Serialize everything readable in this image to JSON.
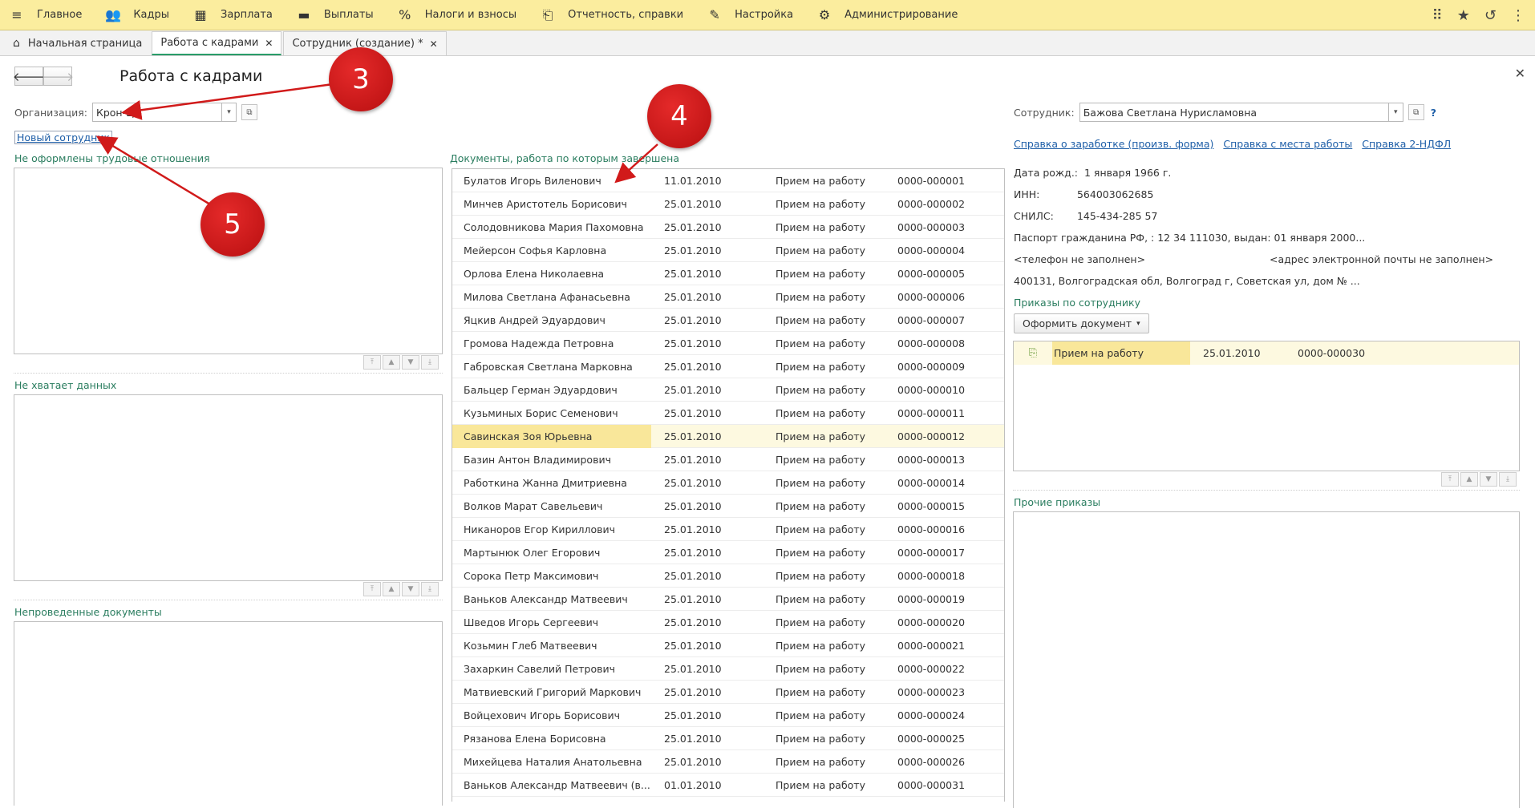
{
  "menu": {
    "items": [
      {
        "label": "Главное",
        "icon": "≡"
      },
      {
        "label": "Кадры",
        "icon": "👥"
      },
      {
        "label": "Зарплата",
        "icon": "▦"
      },
      {
        "label": "Выплаты",
        "icon": "▬"
      },
      {
        "label": "Налоги и взносы",
        "icon": "%"
      },
      {
        "label": "Отчетность, справки",
        "icon": "⎗"
      },
      {
        "label": "Настройка",
        "icon": "✎"
      },
      {
        "label": "Администрирование",
        "icon": "⚙"
      }
    ]
  },
  "tabs": [
    {
      "label": "Начальная страница"
    },
    {
      "label": "Работа с кадрами"
    },
    {
      "label": "Сотрудник (создание) *"
    }
  ],
  "form": {
    "title": "Работа с кадрами",
    "org_label": "Организация:",
    "org_value": "Крон-Ц",
    "new_employee_link": "Новый сотрудник"
  },
  "sections": {
    "not_formalized": "Не оформлены трудовые отношения",
    "missing_data": "Не хватает данных",
    "unposted_docs": "Непроведенные документы",
    "completed_docs": "Документы, работа по которым завершена",
    "employee_orders": "Приказы по сотруднику",
    "other_orders": "Прочие приказы"
  },
  "documents": [
    {
      "name": "Булатов Игорь Виленович",
      "date": "11.01.2010",
      "type": "Прием на работу",
      "num": "0000-000001"
    },
    {
      "name": "Минчев Аристотель Борисович",
      "date": "25.01.2010",
      "type": "Прием на работу",
      "num": "0000-000002"
    },
    {
      "name": "Солодовникова Мария Пахомовна",
      "date": "25.01.2010",
      "type": "Прием на работу",
      "num": "0000-000003"
    },
    {
      "name": "Мейерсон Софья Карловна",
      "date": "25.01.2010",
      "type": "Прием на работу",
      "num": "0000-000004"
    },
    {
      "name": "Орлова Елена Николаевна",
      "date": "25.01.2010",
      "type": "Прием на работу",
      "num": "0000-000005"
    },
    {
      "name": "Милова Светлана Афанасьевна",
      "date": "25.01.2010",
      "type": "Прием на работу",
      "num": "0000-000006"
    },
    {
      "name": "Яцкив Андрей Эдуардович",
      "date": "25.01.2010",
      "type": "Прием на работу",
      "num": "0000-000007"
    },
    {
      "name": "Громова Надежда Петровна",
      "date": "25.01.2010",
      "type": "Прием на работу",
      "num": "0000-000008"
    },
    {
      "name": "Габровская Светлана Марковна",
      "date": "25.01.2010",
      "type": "Прием на работу",
      "num": "0000-000009"
    },
    {
      "name": "Бальцер Герман Эдуардович",
      "date": "25.01.2010",
      "type": "Прием на работу",
      "num": "0000-000010"
    },
    {
      "name": "Кузьминых Борис Семенович",
      "date": "25.01.2010",
      "type": "Прием на работу",
      "num": "0000-000011"
    },
    {
      "name": "Савинская Зоя Юрьевна",
      "date": "25.01.2010",
      "type": "Прием на работу",
      "num": "0000-000012",
      "selected": true
    },
    {
      "name": "Базин Антон Владимирович",
      "date": "25.01.2010",
      "type": "Прием на работу",
      "num": "0000-000013"
    },
    {
      "name": "Работкина Жанна Дмитриевна",
      "date": "25.01.2010",
      "type": "Прием на работу",
      "num": "0000-000014"
    },
    {
      "name": "Волков Марат Савельевич",
      "date": "25.01.2010",
      "type": "Прием на работу",
      "num": "0000-000015"
    },
    {
      "name": "Никаноров Егор Кириллович",
      "date": "25.01.2010",
      "type": "Прием на работу",
      "num": "0000-000016"
    },
    {
      "name": "Мартынюк Олег Егорович",
      "date": "25.01.2010",
      "type": "Прием на работу",
      "num": "0000-000017"
    },
    {
      "name": "Сорока Петр Максимович",
      "date": "25.01.2010",
      "type": "Прием на работу",
      "num": "0000-000018"
    },
    {
      "name": "Ваньков Александр Матвеевич",
      "date": "25.01.2010",
      "type": "Прием на работу",
      "num": "0000-000019"
    },
    {
      "name": "Шведов Игорь Сергеевич",
      "date": "25.01.2010",
      "type": "Прием на работу",
      "num": "0000-000020"
    },
    {
      "name": "Козьмин Глеб Матвеевич",
      "date": "25.01.2010",
      "type": "Прием на работу",
      "num": "0000-000021"
    },
    {
      "name": "Захаркин Савелий Петрович",
      "date": "25.01.2010",
      "type": "Прием на работу",
      "num": "0000-000022"
    },
    {
      "name": "Матвиевский Григорий Маркович",
      "date": "25.01.2010",
      "type": "Прием на работу",
      "num": "0000-000023"
    },
    {
      "name": "Войцехович Игорь Борисович",
      "date": "25.01.2010",
      "type": "Прием на работу",
      "num": "0000-000024"
    },
    {
      "name": "Рязанова Елена Борисовна",
      "date": "25.01.2010",
      "type": "Прием на работу",
      "num": "0000-000025"
    },
    {
      "name": "Михейцева Наталия Анатольевна",
      "date": "25.01.2010",
      "type": "Прием на работу",
      "num": "0000-000026"
    },
    {
      "name": "Ваньков Александр Матвеевич (в...",
      "date": "01.01.2010",
      "type": "Прием на работу",
      "num": "0000-000031"
    }
  ],
  "employee": {
    "label": "Сотрудник:",
    "value": "Бажова Светлана Нурисламовна",
    "help": "?",
    "links": [
      "Справка о заработке (произв. форма)",
      "Справка с места работы",
      "Справка 2-НДФЛ"
    ],
    "birth_label": "Дата рожд.:",
    "birth": "1 января 1966 г.",
    "inn_label": "ИНН:",
    "inn": "564003062685",
    "snils_label": "СНИЛС:",
    "snils": "145-434-285 57",
    "passport": "Паспорт гражданина РФ, : 12 34 111030, выдан: 01 января 2000...",
    "phone": "<телефон не заполнен>",
    "email": "<адрес электронной почты не заполнен>",
    "address": "400131, Волгоградская обл, Волгоград г, Советская ул, дом № ...",
    "oformit_btn": "Оформить документ",
    "orders": [
      {
        "type": "Прием на работу",
        "date": "25.01.2010",
        "num": "0000-000030"
      }
    ]
  },
  "annotations": [
    "3",
    "4",
    "5"
  ],
  "colors": {
    "topbar": "#fbed9e",
    "section_title": "#2a7d5f",
    "link": "#1f5fa8",
    "selected_row": "#f9e79a",
    "marker": "#c81416"
  }
}
